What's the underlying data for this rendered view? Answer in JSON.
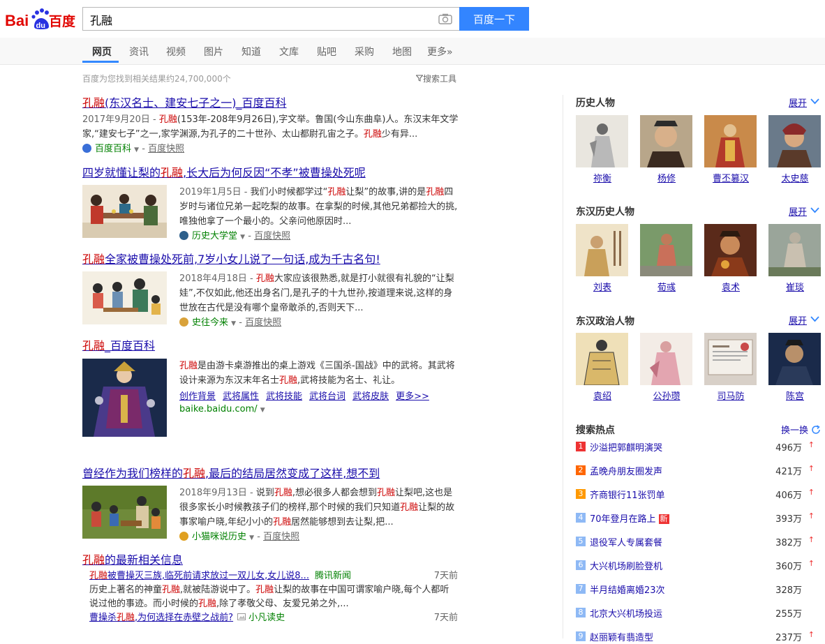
{
  "logo": {
    "bai": "Bai",
    "du": "du",
    "baidu_cn": "百度"
  },
  "search": {
    "query": "孔融",
    "button": "百度一下"
  },
  "nav": [
    "网页",
    "资讯",
    "视频",
    "图片",
    "知道",
    "文库",
    "贴吧",
    "采购",
    "地图",
    "更多»"
  ],
  "result_count": "百度为您找到相关结果约24,700,000个",
  "search_tools": "搜索工具",
  "results": [
    {
      "title_hl": "孔融",
      "title_rest": "(东汉名士、建安七子之一)_百度百科",
      "date": "2017年9月20日 - ",
      "abs_parts": [
        "",
        "孔融",
        "(153年-208年9月26日),字文举。鲁国(今山东曲阜)人。东汉末年文学家,“建安七子”之一,家学渊源,为孔子的二十世孙、太山都尉孔宙之子。",
        "孔融",
        "少有异..."
      ],
      "source": "百度百科",
      "snapshot": "百度快照"
    },
    {
      "title_pre": "四岁就懂让梨的",
      "title_hl": "孔融",
      "title_rest": ",长大后为何反因“不孝”被曹操处死呢",
      "date": "2019年1月5日 - ",
      "abs_parts": [
        "我们小时候都学过“",
        "孔融",
        "让梨”的故事,讲的是",
        "孔融",
        "四岁时与诸位兄弟一起吃梨的故事。在拿梨的时候,其他兄弟都捡大的挑,唯独他拿了一个最小的。父亲问他原因时..."
      ],
      "source": "历史大学堂",
      "snapshot": "百度快照"
    },
    {
      "title_hl": "孔融",
      "title_rest": "全家被曹操处死前,7岁小女儿说了一句话,成为千古名句!",
      "date": "2018年4月18日 - ",
      "abs_parts": [
        "",
        "孔融",
        "大家应该很熟悉,就是打小就很有礼貌的“让梨娃”,不仅如此,他还出身名门,是孔子的十九世孙,按道理来说,这样的身世放在古代是没有哪个皇帝敢杀的,否则天下..."
      ],
      "source": "史往今来",
      "snapshot": "百度快照"
    },
    {
      "title_hl": "孔融",
      "title_rest": "_百度百科",
      "abs_parts": [
        "",
        "孔融",
        "是由游卡桌游推出的桌上游戏《三国杀-国战》中的武将。其武将设计来源为东汉末年名士",
        "孔融",
        ",武将技能为名士、礼让。"
      ],
      "links": [
        "创作背景",
        "武将属性",
        "武将技能",
        "武将台词",
        "武将皮肤",
        "更多>>"
      ],
      "url": "baike.baidu.com/"
    },
    {
      "title_pre": "曾经作为我们榜样的",
      "title_hl": "孔融",
      "title_rest": ",最后的结局居然变成了这样,想不到",
      "date": "2018年9月13日 - ",
      "abs_parts": [
        "说到",
        "孔融",
        ",想必很多人都会想到",
        "孔融",
        "让梨吧,这也是很多家长小时候教孩子们的榜样,那个时候的我们只知道",
        "孔融",
        "让梨的故事家喻户晓,年纪小小的",
        "孔融",
        "居然能够想到去让梨,把..."
      ],
      "source": "小猫咪说历史",
      "snapshot": "百度快照"
    }
  ],
  "news": {
    "title_hl": "孔融",
    "title_rest": "的最新相关信息",
    "items": [
      {
        "title_hl": "孔融",
        "title_rest": "被曹操灭三族,临死前请求放过一双儿女,女儿说8...",
        "source": "腾讯新闻",
        "date": "7天前"
      },
      {
        "title_pre": "曹操杀",
        "title_hl": "孔融",
        "title_rest": ",为何选择在赤壁之战前?",
        "source": "小凡读史",
        "date": "7天前"
      }
    ],
    "abs_parts": [
      "历史上著名的神童",
      "孔融",
      ",就被陆游说中了。",
      "孔融",
      "让梨的故事在中国可谓家喻户晓,每个人都听说过他的事迹。而小时候的",
      "孔融",
      ",除了孝敬父母、友爱兄弟之外,..."
    ]
  },
  "sidebar": {
    "expand_label": "展开",
    "sections": [
      {
        "title": "历史人物",
        "people": [
          "祢衡",
          "杨修",
          "曹丕篡汉",
          "太史慈"
        ]
      },
      {
        "title": "东汉历史人物",
        "people": [
          "刘表",
          "荀彧",
          "袁术",
          "崔琰"
        ]
      },
      {
        "title": "东汉政治人物",
        "people": [
          "袁绍",
          "公孙瓒",
          "司马防",
          "陈宫"
        ]
      }
    ],
    "hot": {
      "title": "搜索热点",
      "refresh": "换一换",
      "new_badge": "新",
      "items": [
        {
          "rank": "1",
          "title": "沙溢把郭麒明演哭",
          "count": "496万",
          "up": true
        },
        {
          "rank": "2",
          "title": "孟晚舟朋友圈发声",
          "count": "421万",
          "up": true
        },
        {
          "rank": "3",
          "title": "齐商银行11张罚单",
          "count": "406万",
          "up": true
        },
        {
          "rank": "4",
          "title": "70年登月在路上",
          "count": "393万",
          "up": true,
          "new": true
        },
        {
          "rank": "5",
          "title": "退役军人专属套餐",
          "count": "382万",
          "up": true
        },
        {
          "rank": "6",
          "title": "大兴机场刷脸登机",
          "count": "360万",
          "up": true
        },
        {
          "rank": "7",
          "title": "半月结婚离婚23次",
          "count": "328万",
          "up": false
        },
        {
          "rank": "8",
          "title": "北京大兴机场投运",
          "count": "255万",
          "up": false
        },
        {
          "rank": "9",
          "title": "赵丽颖有翡造型",
          "count": "237万",
          "up": true
        }
      ]
    }
  },
  "colors": {
    "accent": "#3385ff",
    "link": "#1a0dab",
    "highlight": "#cc0000",
    "source": "#008000",
    "rank_top1": "#e33",
    "rank_top2": "#f60",
    "rank_top3": "#f90",
    "rank_other": "#8eb9f5"
  }
}
